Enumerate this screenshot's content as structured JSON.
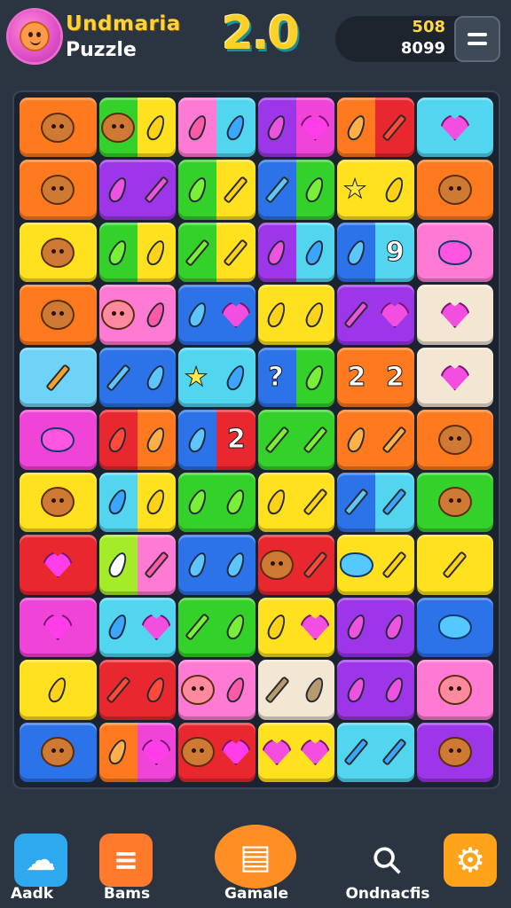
{
  "header": {
    "title_line1": "Undmaria",
    "title_line2": "Puzzle",
    "level": "2.0",
    "score_top": "508",
    "score_bottom": "8099"
  },
  "colors": {
    "background": "#2b3441",
    "accent_yellow": "#ffd02a",
    "accent_orange": "#ffa23a",
    "tile_palette": {
      "orange": "#ff7a1f",
      "yellow": "#ffe11f",
      "green": "#35d12b",
      "cyan": "#52d6f0",
      "blue": "#2c72e8",
      "purple": "#9d35e8",
      "pink": "#ff7ad3",
      "magenta": "#f044d8",
      "red": "#e8282e",
      "cream": "#f3e6d3",
      "lime": "#a4ec2a",
      "sky": "#6fd3f7"
    }
  },
  "board": {
    "rows": 11,
    "cols": 6,
    "tiles": [
      [
        "orange:bear",
        "green:bear|yellow:leaf",
        "pink:leaf|cyan:leaf",
        "purple:leaf|magenta:heart",
        "orange:leaf|red:pen",
        "cyan:heart"
      ],
      [
        "orange:bear",
        "purple:leaf|purple:pen",
        "green:leaf|yellow:pen",
        "blue:pen|green:leaf",
        "yellow:star|yellow:leaf",
        "orange:bear"
      ],
      [
        "yellow:bear",
        "green:leaf|yellow:leaf",
        "green:pen|yellow:pen",
        "purple:leaf|cyan:leaf",
        "blue:leaf|cyan:char9",
        "pink:blob"
      ],
      [
        "orange:bear",
        "pink:bear|pink:leaf",
        "blue:leaf|blue:heart",
        "yellow:leaf|yellow:leaf",
        "purple:pen|purple:heart",
        "cream:heart"
      ],
      [
        "sky:pen",
        "blue:pen|blue:leaf",
        "cyan:star|cyan:leaf",
        "blue:char?|green:leaf",
        "orange:char2|orange:char2",
        "cream:heart"
      ],
      [
        "magenta:blob",
        "red:leaf|orange:leaf",
        "blue:leaf|red:char2",
        "green:pen|green:pen",
        "orange:leaf|orange:pen",
        "orange:bear"
      ],
      [
        "yellow:bear",
        "cyan:leaf|yellow:leaf",
        "green:leaf|green:leaf",
        "yellow:leaf|yellow:pen",
        "blue:pen|cyan:pen",
        "green:bear"
      ],
      [
        "red:heart",
        "lime:leaf|pink:pen",
        "blue:leaf|blue:leaf",
        "red:bear|red:pen",
        "yellow:blob|yellow:pen",
        "yellow:pen"
      ],
      [
        "magenta:heart",
        "cyan:leaf|cyan:heart",
        "green:pen|green:leaf",
        "yellow:leaf|yellow:heart",
        "purple:leaf|purple:leaf",
        "blue:blob"
      ],
      [
        "yellow:leaf",
        "red:pen|red:leaf",
        "pink:bear|pink:leaf",
        "cream:pen|cream:leaf",
        "purple:leaf|purple:leaf",
        "pink:bear"
      ],
      [
        "blue:bear",
        "orange:leaf|magenta:heart",
        "red:bear|red:heart",
        "yellow:heart|yellow:heart",
        "cyan:pen|cyan:pen",
        "purple:bear"
      ]
    ]
  },
  "nav": {
    "items": [
      {
        "label": "Aadk",
        "icon": "cloud-icon",
        "color": "#2ea9f0"
      },
      {
        "label": "Bams",
        "icon": "cake-icon",
        "color": "#ff7a2a"
      },
      {
        "label": "Gamale",
        "icon": "note-card-icon",
        "color": "#ff8f25"
      },
      {
        "label": "Ondnacfis",
        "icon": "search-icon",
        "color": "#2b3441"
      },
      {
        "label": "",
        "icon": "gear-icon",
        "color": "#ffa31a"
      }
    ]
  }
}
